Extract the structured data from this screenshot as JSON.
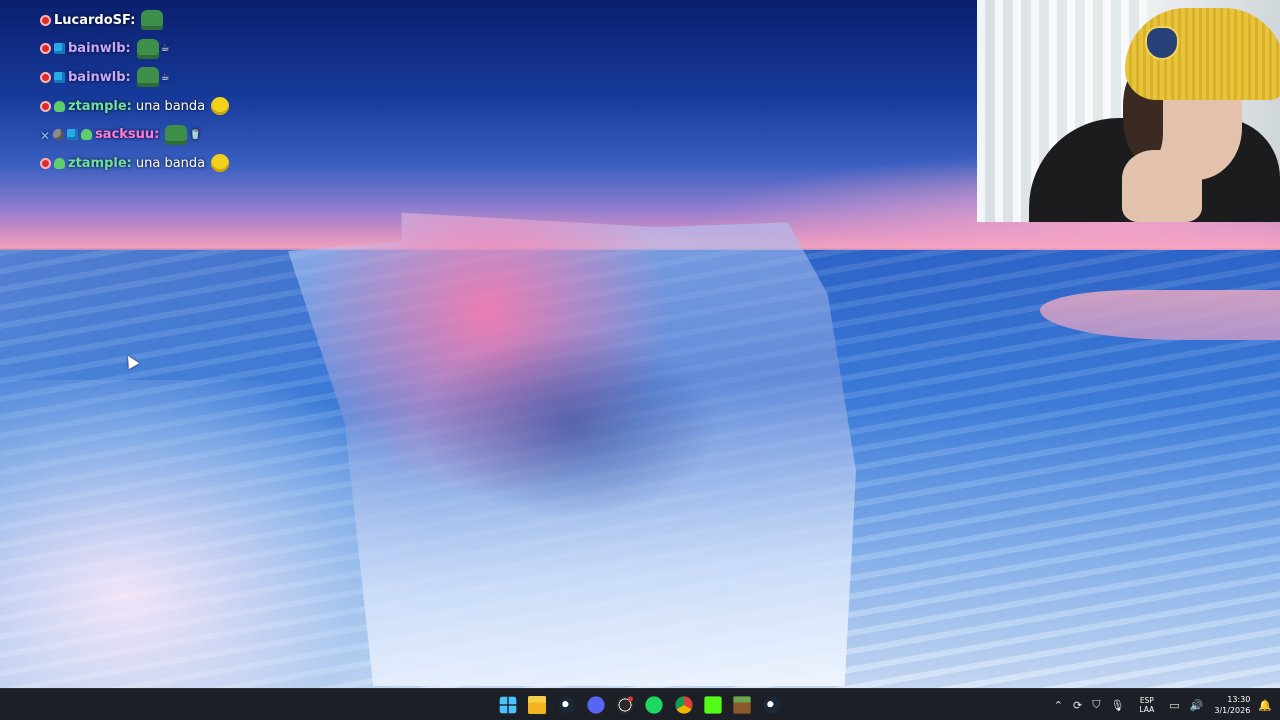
{
  "chat": {
    "messages": [
      {
        "badges": [
          "no-entry-badge"
        ],
        "user": "LucardoSF:",
        "user_color": "#ffffff",
        "text": "",
        "emotes": [
          "frog-emote"
        ]
      },
      {
        "badges": [
          "no-entry-badge",
          "cube-badge"
        ],
        "user": "bainwlb:",
        "user_color": "#c9a8ff",
        "text": "",
        "emotes": [
          "frog-emote",
          "coffee-emote"
        ]
      },
      {
        "badges": [
          "no-entry-badge",
          "cube-badge"
        ],
        "user": "bainwlb:",
        "user_color": "#c9a8ff",
        "text": "",
        "emotes": [
          "frog-emote",
          "coffee-emote"
        ]
      },
      {
        "badges": [
          "no-entry-badge",
          "leaf-badge"
        ],
        "user": "ztample:",
        "user_color": "#6fe0a0",
        "text": "una banda",
        "emotes": [
          "grimace-emote"
        ]
      },
      {
        "badges": [
          "sword-badge",
          "moon-badge",
          "cube-badge",
          "leaf-badge"
        ],
        "user": "sacksuu:",
        "user_color": "#ff7ad9",
        "text": "",
        "emotes": [
          "frog-emote",
          "cup-emote"
        ]
      },
      {
        "badges": [
          "no-entry-badge",
          "leaf-badge"
        ],
        "user": "ztample:",
        "user_color": "#6fe0a0",
        "text": "una banda",
        "emotes": [
          "grimace-emote"
        ]
      }
    ]
  },
  "taskbar": {
    "apps": [
      "start",
      "file-explorer",
      "steam",
      "discord",
      "obs",
      "spotify",
      "chrome",
      "kick",
      "minecraft",
      "steam"
    ],
    "tray": {
      "lang_top": "ESP",
      "lang_bottom": "LAA",
      "time": "13:30",
      "date": "3/1/2026"
    }
  },
  "colors": {
    "taskbar_bg": "#1c1f26",
    "start_accent": "#4cc2ff"
  }
}
